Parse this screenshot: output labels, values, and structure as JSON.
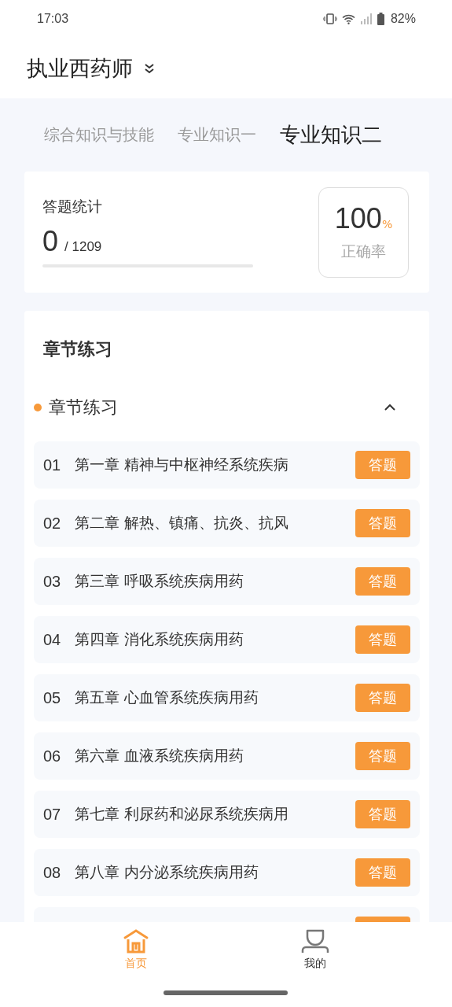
{
  "status_bar": {
    "time": "17:03",
    "battery": "82%"
  },
  "header": {
    "title": "执业西药师"
  },
  "tabs": [
    {
      "label": "综合知识与技能",
      "selected": false
    },
    {
      "label": "专业知识一",
      "selected": false
    },
    {
      "label": "专业知识二",
      "selected": true
    }
  ],
  "stats": {
    "title": "答题统计",
    "answered": "0",
    "total": "/ 1209",
    "progress": {
      "level": 0
    },
    "accuracy": "100",
    "accuracy_unit": "%",
    "accuracy_label": "正确率"
  },
  "practice": {
    "title": "章节练习",
    "section": {
      "label": "章节练习",
      "expanded": true
    },
    "chapters": [
      {
        "number": "01",
        "name": "第一章 精神与中枢神经系统疾病",
        "button": "答题"
      },
      {
        "number": "02",
        "name": "第二章 解热、镇痛、抗炎、抗风",
        "button": "答题"
      },
      {
        "number": "03",
        "name": "第三章 呼吸系统疾病用药",
        "button": "答题"
      },
      {
        "number": "04",
        "name": "第四章 消化系统疾病用药",
        "button": "答题"
      },
      {
        "number": "05",
        "name": "第五章 心血管系统疾病用药",
        "button": "答题"
      },
      {
        "number": "06",
        "name": "第六章 血液系统疾病用药",
        "button": "答题"
      },
      {
        "number": "07",
        "name": "第七章 利尿药和泌尿系统疾病用",
        "button": "答题"
      },
      {
        "number": "08",
        "name": "第八章 内分泌系统疾病用药",
        "button": "答题"
      }
    ]
  },
  "bottom_nav": [
    {
      "label": "首页",
      "kind": "home",
      "selected": true
    },
    {
      "label": "我的",
      "kind": "user",
      "selected": false
    }
  ]
}
